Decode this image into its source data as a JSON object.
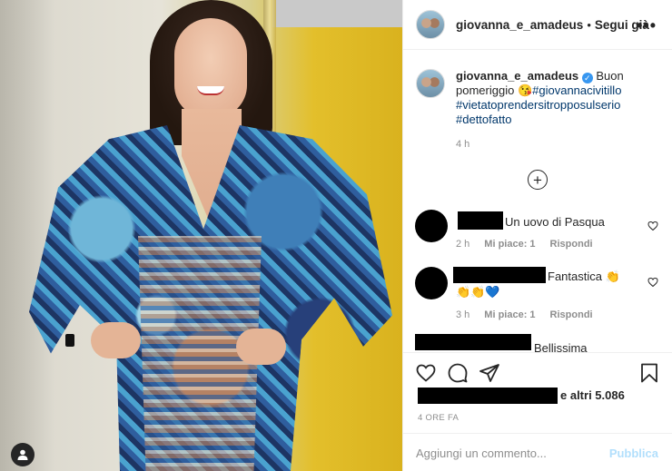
{
  "post": {
    "username": "giovanna_e_amadeus",
    "separator": "•",
    "follow_label": "Segui già",
    "more_label": "•••"
  },
  "caption": {
    "username": "giovanna_e_amadeus",
    "verified_glyph": "✓",
    "text": "Buon pomeriggio",
    "emoji": "😘",
    "hashtags": [
      "#giovannacivitillo",
      "#vietatoprendersitropposulserio",
      "#dettofatto"
    ],
    "time": "4 h"
  },
  "load_more_glyph": "+",
  "comments": [
    {
      "text": "Un uovo di Pasqua",
      "time": "2 h",
      "likes": "Mi piace: 1",
      "reply": "Rispondi"
    },
    {
      "text": "Fantastica 👏",
      "text2": "👏👏💙",
      "time": "3 h",
      "likes": "Mi piace: 1",
      "reply": "Rispondi"
    },
    {
      "text": "Bellissima"
    }
  ],
  "likes": {
    "text": "e altri 5.086"
  },
  "posted_ago": "4 ORE FA",
  "add_comment": {
    "placeholder": "Aggiungi un commento...",
    "publish": "Pubblica"
  },
  "colors": {
    "link": "#00376b",
    "muted": "#8e8e8e",
    "publish_disabled": "#b2dffc",
    "verified": "#3897f0"
  }
}
